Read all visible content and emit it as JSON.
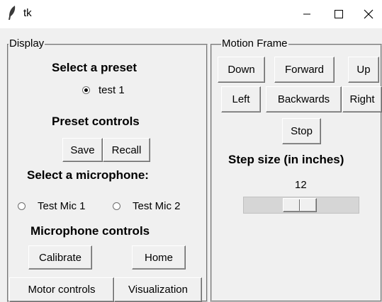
{
  "window": {
    "title": "tk"
  },
  "display": {
    "frame_label": "Display",
    "preset_heading": "Select a preset",
    "presets": [
      {
        "label": "test 1",
        "selected": true
      }
    ],
    "preset_controls_heading": "Preset controls",
    "save_label": "Save",
    "recall_label": "Recall",
    "microphone_heading": "Select a microphone:",
    "microphones": [
      {
        "label": "Test Mic 1",
        "selected": false
      },
      {
        "label": "Test Mic 2",
        "selected": false
      }
    ],
    "mic_controls_heading": "Microphone controls",
    "calibrate_label": "Calibrate",
    "home_label": "Home"
  },
  "tabs": [
    {
      "label": "Motor controls",
      "active": true
    },
    {
      "label": "Visualization",
      "active": false
    }
  ],
  "motion": {
    "frame_label": "Motion Frame",
    "down_label": "Down",
    "forward_label": "Forward",
    "up_label": "Up",
    "left_label": "Left",
    "backwards_label": "Backwards",
    "right_label": "Right",
    "stop_label": "Stop",
    "step_heading": "Step size (in inches)",
    "step_value": "12"
  }
}
